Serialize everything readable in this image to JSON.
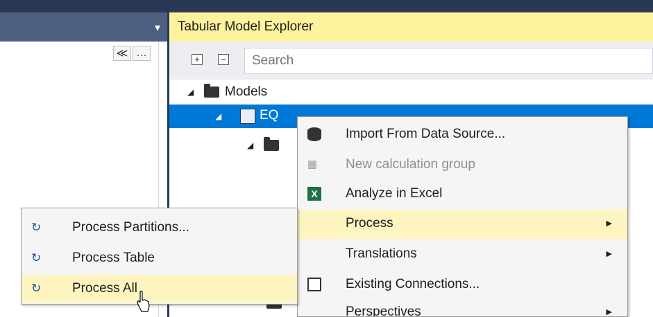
{
  "left_panel": {
    "dropdown_glyph": "▾",
    "tool_buttons": [
      "≪",
      "…"
    ]
  },
  "explorer": {
    "title": "Tabular Model Explorer",
    "expand_all": "+",
    "collapse_all": "−",
    "search_placeholder": "Search",
    "tree": {
      "root_label": "Models",
      "selected_label": "EQ"
    }
  },
  "context_menu": {
    "items": [
      {
        "label": "Import From Data Source...",
        "icon": "database-icon"
      },
      {
        "label": "New calculation group",
        "icon": "calculation-group-icon",
        "disabled": true
      },
      {
        "label": "Analyze in Excel",
        "icon": "excel-icon"
      },
      {
        "label": "Process",
        "submenu": true,
        "highlighted": true
      },
      {
        "label": "Translations",
        "submenu": true
      },
      {
        "label": "Existing Connections...",
        "icon": "connections-icon"
      },
      {
        "label": "Perspectives",
        "submenu": true
      }
    ]
  },
  "process_submenu": {
    "items": [
      {
        "label": "Process Partitions...",
        "icon": "process-icon"
      },
      {
        "label": "Process Table",
        "icon": "process-icon"
      },
      {
        "label": "Process All",
        "icon": "process-all-icon",
        "highlighted": true
      }
    ]
  },
  "colors": {
    "accent_selection": "#0078d7",
    "menu_highlight": "#fdf4bf",
    "header_yellow": "#fff29d",
    "chrome_dark": "#293955"
  }
}
